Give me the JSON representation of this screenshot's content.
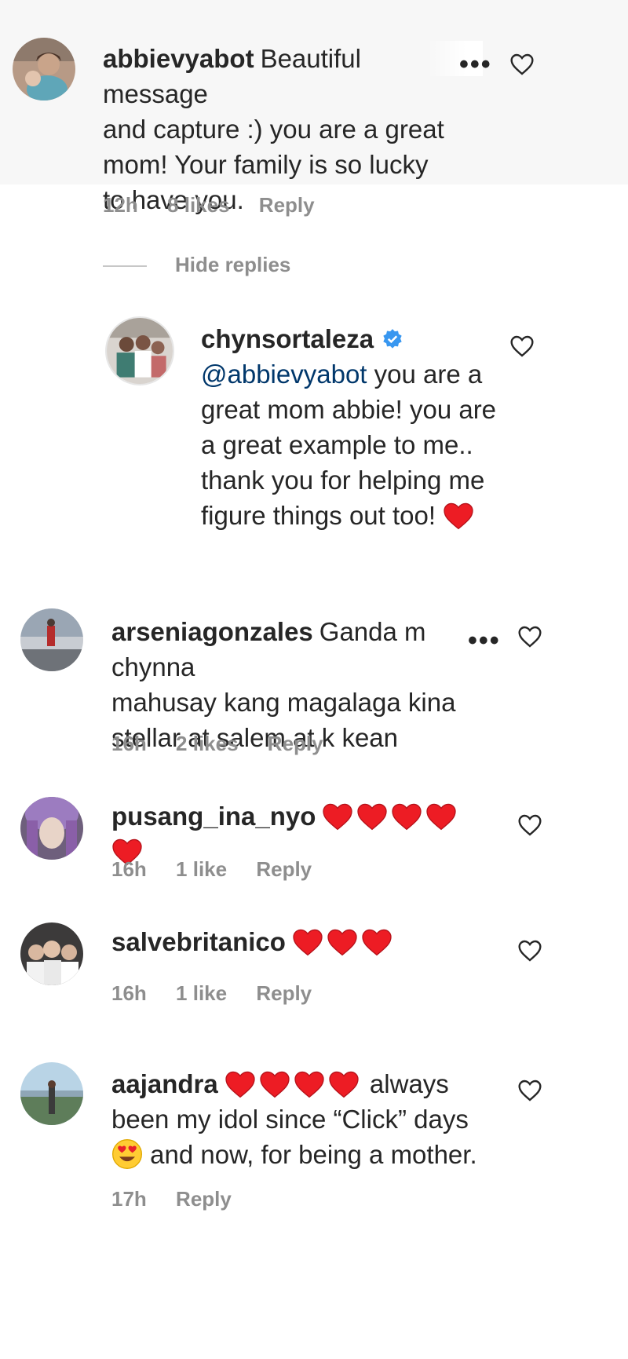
{
  "comments": [
    {
      "username": "abbievyabot",
      "first_line": "Beautiful message",
      "rest": "and capture :) you are a great mom! Your family is so lucky to have you.",
      "time": "12h",
      "likes": "8 likes",
      "reply": "Reply",
      "hide_replies": "Hide replies"
    },
    {
      "username": "chynsortaleza",
      "mention": "@abbievyabot",
      "text": " you are a great mom abbie! you are a great example to me.. thank you for helping me figure things out too!"
    },
    {
      "username": "arseniagonzales",
      "first_line": "Ganda m chynna",
      "rest": "mahusay kang magalaga kina stellar at salem at k kean",
      "time": "16h",
      "likes": "2 likes",
      "reply": "Reply"
    },
    {
      "username": "pusang_ina_nyo",
      "time": "16h",
      "likes": "1 like",
      "reply": "Reply"
    },
    {
      "username": "salvebritanico",
      "time": "16h",
      "likes": "1 like",
      "reply": "Reply"
    },
    {
      "username": "aajandra",
      "after_hearts": "always",
      "line2": "been my idol since “Click” days",
      "line3": " and now, for being a mother.",
      "time": "17h",
      "reply": "Reply"
    }
  ],
  "colors": {
    "heart_red": "#ed1c24",
    "muted": "#8e8e8e",
    "mention": "#00376b",
    "verified_blue": "#3897f0"
  },
  "icons": {
    "like": "heart-outline-icon",
    "more": "more-options-icon",
    "verified": "verified-badge-icon"
  }
}
